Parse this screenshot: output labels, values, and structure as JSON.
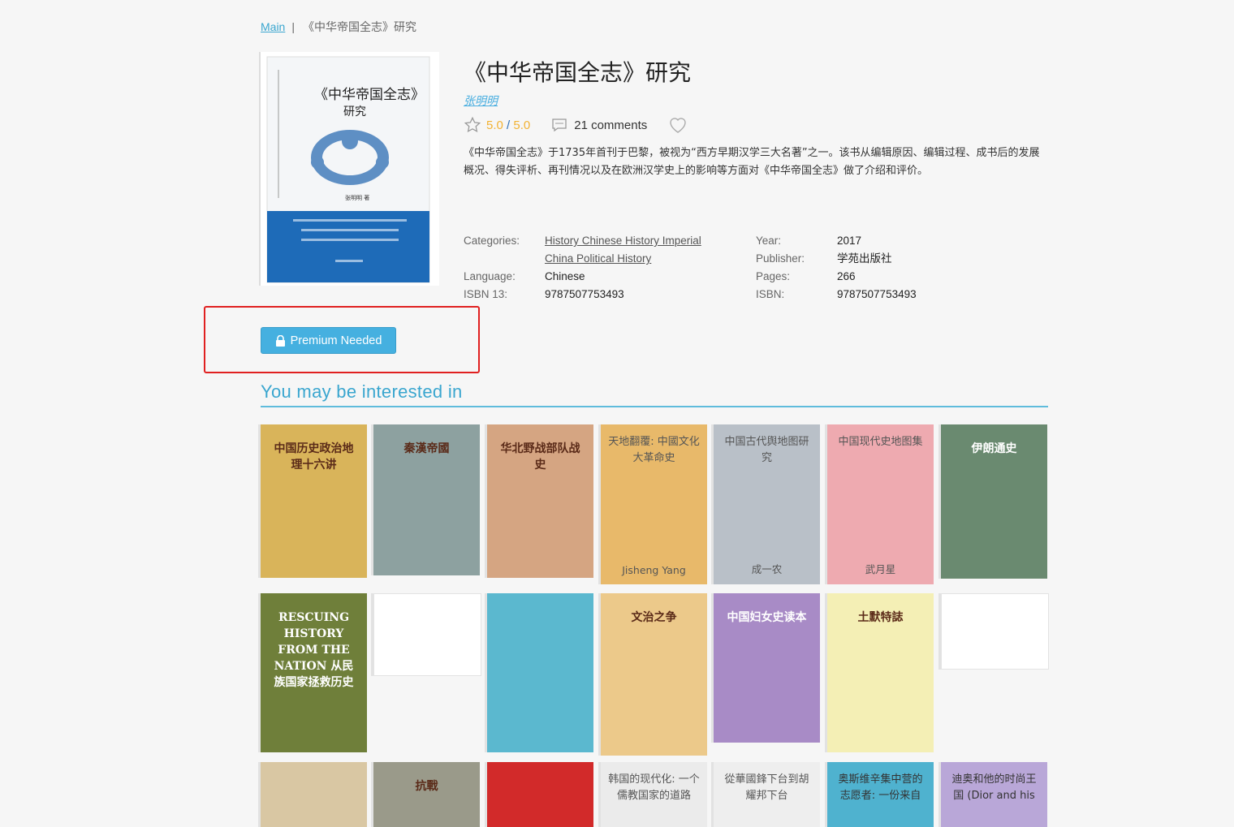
{
  "breadcrumb": {
    "home": "Main",
    "current": "《中华帝国全志》研究"
  },
  "book": {
    "title": "《中华帝国全志》研究",
    "author": "张明明",
    "rating": "5.0",
    "rating_max": "5.0",
    "comments": "21 comments",
    "description": "《中华帝国全志》于1735年首刊于巴黎，被视为“西方早期汉学三大名著”之一。该书从编辑原因、编辑过程、成书后的发展概况、得失评析、再刊情况以及在欧洲汉学史上的影响等方面对《中华帝国全志》做了介绍和评价。",
    "cover": {
      "title_line1": "《中华帝国全志》",
      "title_line2": "研究",
      "author": "张明明 著"
    }
  },
  "details": {
    "categories_label": "Categories:",
    "categories": [
      "History Chinese History Imperial",
      "China Political History"
    ],
    "language_label": "Language:",
    "language": "Chinese",
    "isbn13_label": "ISBN 13:",
    "isbn13": "9787507753493",
    "year_label": "Year:",
    "year": "2017",
    "publisher_label": "Publisher:",
    "publisher": "学苑出版社",
    "pages_label": "Pages:",
    "pages": "266",
    "isbn_label": "ISBN:",
    "isbn": "9787507753493"
  },
  "premium_button": "Premium Needed",
  "interest_heading": "You may be interested in",
  "recommendations": [
    {
      "title": "",
      "author": "",
      "cover_text": "中国历史政治地理十六讲",
      "color": "#d9b45a"
    },
    {
      "title": "",
      "author": "",
      "cover_text": "秦漢帝國",
      "color": "#8da1a0"
    },
    {
      "title": "",
      "author": "",
      "cover_text": "华北野战部队战史",
      "color": "#d5a582"
    },
    {
      "title": "天地翻覆: 中國文化大革命史",
      "author": "Jisheng Yang",
      "cover_text": "",
      "color": "#e8b96a"
    },
    {
      "title": "中国古代舆地图研究",
      "author": "成一农",
      "cover_text": "",
      "color": "#b9c0c8"
    },
    {
      "title": "中国现代史地图集",
      "author": "武月星",
      "cover_text": "",
      "color": "#eeaab0"
    },
    {
      "title": "",
      "author": "",
      "cover_text": "伊朗通史",
      "color": "#6a8a70"
    },
    {
      "title": "",
      "author": "",
      "cover_text": "RESCUING HISTORY FROM THE NATION 从民族国家拯救历史",
      "color": "#6f7f3a"
    },
    {
      "title": "",
      "author": "",
      "cover_text": "",
      "color": "#ffffff"
    },
    {
      "title": "",
      "author": "",
      "cover_text": "",
      "color": "#5bb8cf"
    },
    {
      "title": "",
      "author": "",
      "cover_text": "文治之争",
      "color": "#ecc98a"
    },
    {
      "title": "",
      "author": "",
      "cover_text": "中国妇女史读本",
      "color": "#a88bc6"
    },
    {
      "title": "",
      "author": "",
      "cover_text": "土默特誌",
      "color": "#f4efb5"
    },
    {
      "title": "",
      "author": "",
      "cover_text": "",
      "color": "#ffffff"
    },
    {
      "title": "",
      "author": "",
      "cover_text": "",
      "color": "#d9c7a3"
    },
    {
      "title": "",
      "author": "",
      "cover_text": "抗戰",
      "color": "#9a9a8a"
    },
    {
      "title": "",
      "author": "",
      "cover_text": "",
      "color": "#d22a2a"
    },
    {
      "title": "韩国的现代化: 一个儒教国家的道路",
      "author": "",
      "cover_text": "",
      "color": "#ebebeb"
    },
    {
      "title": "從華國鋒下台到胡耀邦下台",
      "author": "",
      "cover_text": "",
      "color": "#eeeeee"
    },
    {
      "title": "奥斯维辛集中营的志愿者: 一份来自",
      "author": "",
      "cover_text": "",
      "color": "#4fb2cf"
    },
    {
      "title": "迪奥和他的时尚王国 (Dior and his",
      "author": "",
      "cover_text": "",
      "color": "#b9a7d8"
    }
  ]
}
